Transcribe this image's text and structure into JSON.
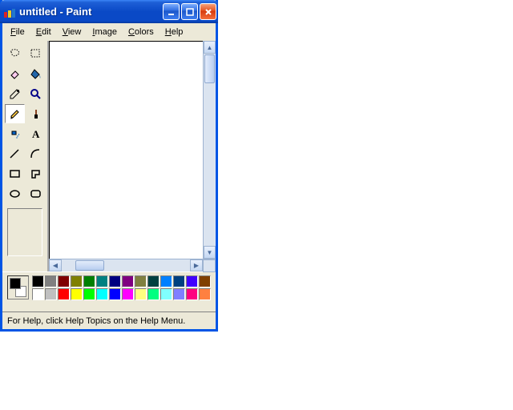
{
  "window": {
    "title": "untitled - Paint"
  },
  "menu": {
    "items": [
      {
        "label": "File",
        "u": 0
      },
      {
        "label": "Edit",
        "u": 0
      },
      {
        "label": "View",
        "u": 0
      },
      {
        "label": "Image",
        "u": 0
      },
      {
        "label": "Colors",
        "u": 0
      },
      {
        "label": "Help",
        "u": 0
      }
    ]
  },
  "tools": [
    {
      "name": "free-form-select"
    },
    {
      "name": "select"
    },
    {
      "name": "eraser"
    },
    {
      "name": "fill"
    },
    {
      "name": "pick-color"
    },
    {
      "name": "magnifier"
    },
    {
      "name": "pencil",
      "selected": true
    },
    {
      "name": "brush"
    },
    {
      "name": "airbrush"
    },
    {
      "name": "text"
    },
    {
      "name": "line"
    },
    {
      "name": "curve"
    },
    {
      "name": "rectangle"
    },
    {
      "name": "polygon"
    },
    {
      "name": "ellipse"
    },
    {
      "name": "rounded-rectangle"
    }
  ],
  "colors": {
    "foreground": "#000000",
    "background": "#ffffff",
    "palette": [
      "#000000",
      "#808080",
      "#800000",
      "#808000",
      "#008000",
      "#008080",
      "#000080",
      "#800080",
      "#808040",
      "#004040",
      "#0080ff",
      "#004080",
      "#4000ff",
      "#804000",
      "#ffffff",
      "#c0c0c0",
      "#ff0000",
      "#ffff00",
      "#00ff00",
      "#00ffff",
      "#0000ff",
      "#ff00ff",
      "#ffff80",
      "#00ff80",
      "#80ffff",
      "#8080ff",
      "#ff0080",
      "#ff8040"
    ]
  },
  "status": {
    "text": "For Help, click Help Topics on the Help Menu."
  }
}
